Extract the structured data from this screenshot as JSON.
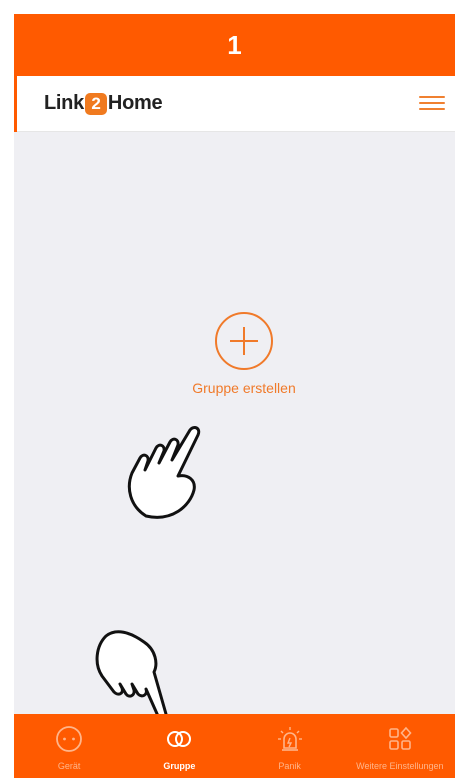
{
  "step_number": "1",
  "header": {
    "logo_prefix": "Link",
    "logo_badge": "2",
    "logo_suffix": "Home",
    "menu_icon": "hamburger-menu-icon"
  },
  "main": {
    "create_group_label": "Gruppe erstellen",
    "create_group_icon": "plus-circle-icon"
  },
  "tabs": [
    {
      "label": "Gerät",
      "icon": "socket-icon",
      "active": false
    },
    {
      "label": "Gruppe",
      "icon": "linked-rings-icon",
      "active": true
    },
    {
      "label": "Panik",
      "icon": "alarm-siren-icon",
      "active": false
    },
    {
      "label": "Weitere Einstellungen",
      "icon": "grid-settings-icon",
      "active": false
    }
  ],
  "colors": {
    "accent": "#ff5a00",
    "brand_orange": "#f07a1f",
    "background": "#efeff3"
  }
}
